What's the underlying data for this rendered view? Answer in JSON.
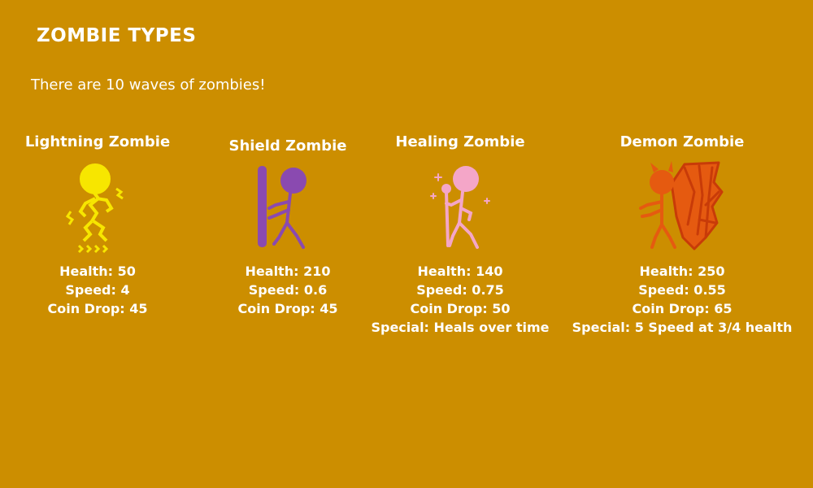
{
  "header": {
    "title": "ZOMBIE TYPES",
    "subtitle": "There are 10 waves of zombies!"
  },
  "zombies": [
    {
      "name": "Lightning Zombie",
      "icon": "lightning-zombie-icon",
      "color": "#f7e600",
      "health": "Health: 50",
      "speed": "Speed: 4",
      "coin_drop": "Coin Drop: 45",
      "special": ""
    },
    {
      "name": "Shield Zombie",
      "icon": "shield-zombie-icon",
      "color": "#8a4ab0",
      "health": "Health: 210",
      "speed": "Speed: 0.6",
      "coin_drop": "Coin Drop: 45",
      "special": ""
    },
    {
      "name": "Healing Zombie",
      "icon": "healing-zombie-icon",
      "color": "#f4a6c8",
      "health": "Health: 140",
      "speed": "Speed: 0.75",
      "coin_drop": "Coin Drop: 50",
      "special": "Special: Heals over time"
    },
    {
      "name": "Demon Zombie",
      "icon": "demon-zombie-icon",
      "color": "#e55a10",
      "health": "Health: 250",
      "speed": "Speed: 0.55",
      "coin_drop": "Coin Drop: 65",
      "special": "Special: 5 Speed at 3/4 health"
    }
  ],
  "colors": {
    "background": "#cc8e00",
    "text": "#ffffff"
  }
}
